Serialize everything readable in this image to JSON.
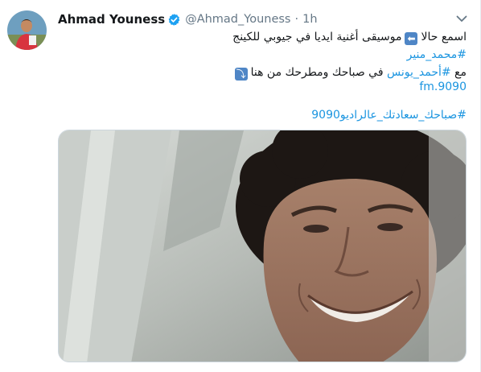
{
  "tweet": {
    "display_name": "Ahmad Youness",
    "handle": "@Ahmad_Youness",
    "separator": "·",
    "time": "1h",
    "line1_text": "اسمع حالا",
    "line1_emoji": "⬅",
    "line1_rest": "موسيقى أغنية ايديا في جيوبي للكينج",
    "line1_hashtag": "#محمد_منير",
    "line3_prefix": "مع",
    "line3_hashtag": "#أحمد_يونس",
    "line3_rest": "في صباحك ومطرحك من هنا",
    "line3_emoji": "⤵",
    "link": "9090.fm",
    "hashtag_footer": "#صباحك_سعادتك_عالراديو9090"
  },
  "icons": {
    "verified": "verified-badge-icon",
    "caret": "chevron-down-icon"
  },
  "colors": {
    "link": "#1b95e0",
    "verified": "#1da1f2",
    "secondary_text": "#657786"
  }
}
